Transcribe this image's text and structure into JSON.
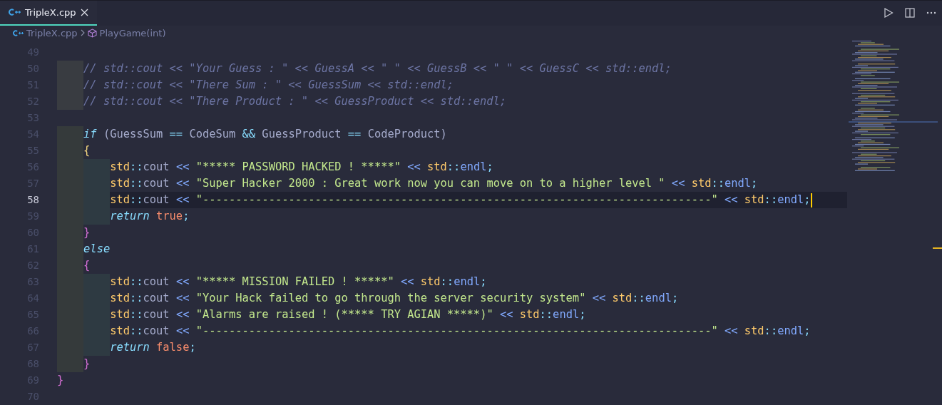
{
  "tabs": [
    {
      "label": "TripleX.cpp",
      "kind": "cpp",
      "selected": true
    }
  ],
  "breadcrumbs": [
    {
      "label": "TripleX.cpp",
      "kind": "cpp"
    },
    {
      "label": "PlayGame(int)",
      "kind": "method"
    }
  ],
  "lines": [
    {
      "children": [
        {
          "number": "49",
          "current": false
        },
        {
          "number": "50",
          "current": false,
          "tokens": [
            {
              "kind": "comment",
              "text": "// std::cout << \"Your Guess : \" << GuessA << \" \" << GuessB << \" \" << GuessC << std::endl;"
            }
          ]
        },
        {
          "number": "51",
          "current": false,
          "tokens": [
            {
              "kind": "comment",
              "text": "// std::cout << \"There Sum : \" << GuessSum << std::endl;"
            }
          ]
        },
        {
          "number": "52",
          "current": false,
          "tokens": [
            {
              "kind": "comment",
              "text": "// std::cout << \"There Product : \" << GuessProduct << std::endl;"
            }
          ]
        },
        {
          "number": "53",
          "current": false
        },
        {
          "number": "54",
          "current": false,
          "tokens": [
            {
              "kind": "kw",
              "text": "if "
            },
            {
              "kind": "punct",
              "text": "("
            },
            {
              "kind": "name",
              "text": "GuessSum "
            },
            {
              "kind": "op",
              "text": "== "
            },
            {
              "kind": "name",
              "text": "CodeSum "
            },
            {
              "kind": "op",
              "text": "&& "
            },
            {
              "kind": "name",
              "text": "GuessProduct "
            },
            {
              "kind": "op",
              "text": "== "
            },
            {
              "kind": "name",
              "text": "CodeProduct"
            },
            {
              "kind": "punct",
              "text": ")"
            }
          ]
        },
        {
          "number": "55",
          "current": false,
          "tokens": [
            {
              "kind": "brace",
              "color": "#f2d57e",
              "text": "{"
            }
          ],
          "children": [
            {
              "number": "56",
              "current": false,
              "tokens": [
                {
                  "kind": "ns",
                  "text": "std"
                },
                {
                  "kind": "op",
                  "text": "::"
                },
                {
                  "kind": "fn",
                  "text": "cout "
                },
                {
                  "kind": "stream",
                  "text": "<< "
                },
                {
                  "kind": "str",
                  "text": "\"***** PASSWORD HACKED ! *****\" "
                },
                {
                  "kind": "stream",
                  "text": "<< "
                },
                {
                  "kind": "ns",
                  "text": "std"
                },
                {
                  "kind": "op",
                  "text": "::"
                },
                {
                  "kind": "endl",
                  "text": "endl"
                },
                {
                  "kind": "op",
                  "text": ";"
                }
              ]
            },
            {
              "number": "57",
              "current": false,
              "tokens": [
                {
                  "kind": "ns",
                  "text": "std"
                },
                {
                  "kind": "op",
                  "text": "::"
                },
                {
                  "kind": "fn",
                  "text": "cout "
                },
                {
                  "kind": "stream",
                  "text": "<< "
                },
                {
                  "kind": "str",
                  "text": "\"Super Hacker 2000 : Great work now you can move on to a higher level \" "
                },
                {
                  "kind": "stream",
                  "text": "<< "
                },
                {
                  "kind": "ns",
                  "text": "std"
                },
                {
                  "kind": "op",
                  "text": "::"
                },
                {
                  "kind": "endl",
                  "text": "endl"
                },
                {
                  "kind": "op",
                  "text": ";"
                }
              ]
            },
            {
              "number": "58",
              "current": true,
              "tokens": [
                {
                  "kind": "ns",
                  "text": "std"
                },
                {
                  "kind": "op",
                  "text": "::"
                },
                {
                  "kind": "fn",
                  "text": "cout "
                },
                {
                  "kind": "stream",
                  "text": "<< "
                },
                {
                  "kind": "str",
                  "text": "\"-----------------------------------------------------------------------------\" "
                },
                {
                  "kind": "stream",
                  "text": "<< "
                },
                {
                  "kind": "ns",
                  "text": "std"
                },
                {
                  "kind": "op",
                  "text": "::"
                },
                {
                  "kind": "endl",
                  "text": "endl"
                },
                {
                  "kind": "op",
                  "text": ";"
                }
              ]
            },
            {
              "number": "59",
              "current": false,
              "tokens": [
                {
                  "kind": "kw",
                  "text": "return "
                },
                {
                  "kind": "lit",
                  "text": "true"
                },
                {
                  "kind": "op",
                  "text": ";"
                }
              ]
            }
          ]
        },
        {
          "number": "60",
          "current": false,
          "tokens": [
            {
              "kind": "brace",
              "color": "#d36fd3",
              "text": "}"
            }
          ]
        },
        {
          "number": "61",
          "current": false,
          "tokens": [
            {
              "kind": "kw",
              "text": "else"
            }
          ]
        },
        {
          "number": "62",
          "current": false,
          "tokens": [
            {
              "kind": "brace",
              "color": "#d36fd3",
              "text": "{"
            }
          ],
          "children": [
            {
              "number": "63",
              "current": false,
              "tokens": [
                {
                  "kind": "ns",
                  "text": "std"
                },
                {
                  "kind": "op",
                  "text": "::"
                },
                {
                  "kind": "fn",
                  "text": "cout "
                },
                {
                  "kind": "stream",
                  "text": "<< "
                },
                {
                  "kind": "str",
                  "text": "\"***** MISSION FAILED ! *****\" "
                },
                {
                  "kind": "stream",
                  "text": "<< "
                },
                {
                  "kind": "ns",
                  "text": "std"
                },
                {
                  "kind": "op",
                  "text": "::"
                },
                {
                  "kind": "endl",
                  "text": "endl"
                },
                {
                  "kind": "op",
                  "text": ";"
                }
              ]
            },
            {
              "number": "64",
              "current": false,
              "tokens": [
                {
                  "kind": "ns",
                  "text": "std"
                },
                {
                  "kind": "op",
                  "text": "::"
                },
                {
                  "kind": "fn",
                  "text": "cout "
                },
                {
                  "kind": "stream",
                  "text": "<< "
                },
                {
                  "kind": "str",
                  "text": "\"Your Hack failed to go through the server security system\" "
                },
                {
                  "kind": "stream",
                  "text": "<< "
                },
                {
                  "kind": "ns",
                  "text": "std"
                },
                {
                  "kind": "op",
                  "text": "::"
                },
                {
                  "kind": "endl",
                  "text": "endl"
                },
                {
                  "kind": "op",
                  "text": ";"
                }
              ]
            },
            {
              "number": "65",
              "current": false,
              "tokens": [
                {
                  "kind": "ns",
                  "text": "std"
                },
                {
                  "kind": "op",
                  "text": "::"
                },
                {
                  "kind": "fn",
                  "text": "cout "
                },
                {
                  "kind": "stream",
                  "text": "<< "
                },
                {
                  "kind": "str",
                  "text": "\"Alarms are raised ! (***** TRY AGIAN *****)\" "
                },
                {
                  "kind": "stream",
                  "text": "<< "
                },
                {
                  "kind": "ns",
                  "text": "std"
                },
                {
                  "kind": "op",
                  "text": "::"
                },
                {
                  "kind": "endl",
                  "text": "endl"
                },
                {
                  "kind": "op",
                  "text": ";"
                }
              ]
            },
            {
              "number": "66",
              "current": false,
              "tokens": [
                {
                  "kind": "ns",
                  "text": "std"
                },
                {
                  "kind": "op",
                  "text": "::"
                },
                {
                  "kind": "fn",
                  "text": "cout "
                },
                {
                  "kind": "stream",
                  "text": "<< "
                },
                {
                  "kind": "str",
                  "text": "\"-----------------------------------------------------------------------------\" "
                },
                {
                  "kind": "stream",
                  "text": "<< "
                },
                {
                  "kind": "ns",
                  "text": "std"
                },
                {
                  "kind": "op",
                  "text": "::"
                },
                {
                  "kind": "endl",
                  "text": "endl"
                },
                {
                  "kind": "op",
                  "text": ";"
                }
              ]
            },
            {
              "number": "67",
              "current": false,
              "tokens": [
                {
                  "kind": "kw",
                  "text": "return "
                },
                {
                  "kind": "lit",
                  "text": "false"
                },
                {
                  "kind": "op",
                  "text": ";"
                }
              ]
            }
          ]
        },
        {
          "number": "68",
          "current": false,
          "tokens": [
            {
              "kind": "brace",
              "color": "#d36fd3",
              "text": "}"
            }
          ]
        }
      ]
    },
    {
      "number": "69",
      "current": false,
      "tokens": [
        {
          "kind": "brace",
          "color": "#d36fd3",
          "text": "}"
        }
      ]
    },
    {
      "number": "70",
      "current": false
    }
  ]
}
